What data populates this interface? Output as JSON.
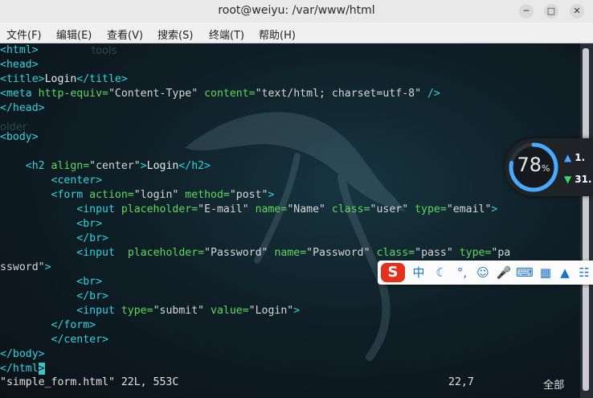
{
  "window": {
    "title": "root@weiyu: /var/www/html"
  },
  "menu": [
    "文件(F)",
    "编辑(E)",
    "查看(V)",
    "搜索(S)",
    "终端(T)",
    "帮助(H)"
  ],
  "desktop_ghost": {
    "tools": "tools",
    "folder": "older"
  },
  "editor": {
    "lines": [
      [
        [
          "tag",
          "<html>"
        ]
      ],
      [
        [
          "tag",
          "<head>"
        ]
      ],
      [
        [
          "tag",
          "<title>"
        ],
        [
          "txt",
          "Login"
        ],
        [
          "tag",
          "</title>"
        ]
      ],
      [
        [
          "tag",
          "<meta "
        ],
        [
          "attr",
          "http-equiv="
        ],
        [
          "str",
          "\"Content-Type\" "
        ],
        [
          "attr",
          "content="
        ],
        [
          "str",
          "\"text/html; charset=utf-8\" "
        ],
        [
          "tag",
          "/>"
        ]
      ],
      [
        [
          "tag",
          "</head>"
        ]
      ],
      [],
      [
        [
          "tag",
          "<body>"
        ]
      ],
      [],
      [
        [
          "txt",
          "    "
        ],
        [
          "tag",
          "<h2 "
        ],
        [
          "attr",
          "align="
        ],
        [
          "str",
          "\"center\""
        ],
        [
          "tag",
          ">"
        ],
        [
          "txt",
          "Login"
        ],
        [
          "tag",
          "</h2>"
        ]
      ],
      [
        [
          "txt",
          "        "
        ],
        [
          "tag",
          "<center>"
        ]
      ],
      [
        [
          "txt",
          "        "
        ],
        [
          "tag",
          "<form "
        ],
        [
          "attr",
          "action="
        ],
        [
          "str",
          "\"login\" "
        ],
        [
          "attr",
          "method="
        ],
        [
          "str",
          "\"post\""
        ],
        [
          "tag",
          ">"
        ]
      ],
      [
        [
          "txt",
          "            "
        ],
        [
          "tag",
          "<input "
        ],
        [
          "attr",
          "placeholder="
        ],
        [
          "str",
          "\"E-mail\" "
        ],
        [
          "attr",
          "name="
        ],
        [
          "str",
          "\"Name\" "
        ],
        [
          "attr",
          "class="
        ],
        [
          "str",
          "\"user\" "
        ],
        [
          "attr",
          "type="
        ],
        [
          "str",
          "\"email\""
        ],
        [
          "tag",
          ">"
        ]
      ],
      [
        [
          "txt",
          "            "
        ],
        [
          "tag",
          "<br>"
        ]
      ],
      [
        [
          "txt",
          "            "
        ],
        [
          "tag",
          "</br>"
        ]
      ],
      [
        [
          "txt",
          "            "
        ],
        [
          "tag",
          "<input  "
        ],
        [
          "attr",
          "placeholder="
        ],
        [
          "str",
          "\"Password\" "
        ],
        [
          "attr",
          "name="
        ],
        [
          "str",
          "\"Password\" "
        ],
        [
          "attr",
          "class="
        ],
        [
          "str",
          "\"pass\" "
        ],
        [
          "attr",
          "type="
        ],
        [
          "str",
          "\"pa"
        ]
      ],
      [
        [
          "str",
          "ssword\""
        ],
        [
          "tag",
          ">"
        ]
      ],
      [
        [
          "txt",
          "            "
        ],
        [
          "tag",
          "<br>"
        ]
      ],
      [
        [
          "txt",
          "            "
        ],
        [
          "tag",
          "</br>"
        ]
      ],
      [
        [
          "txt",
          "            "
        ],
        [
          "tag",
          "<input "
        ],
        [
          "attr",
          "type="
        ],
        [
          "str",
          "\"submit\" "
        ],
        [
          "attr",
          "value="
        ],
        [
          "str",
          "\"Login\""
        ],
        [
          "tag",
          ">"
        ]
      ],
      [
        [
          "txt",
          "        "
        ],
        [
          "tag",
          "</form>"
        ]
      ],
      [
        [
          "txt",
          "        "
        ],
        [
          "tag",
          "</center>"
        ]
      ],
      [
        [
          "tag",
          "</body>"
        ]
      ],
      [
        [
          "tag",
          "</html"
        ],
        [
          "cursor",
          ">"
        ]
      ]
    ],
    "status": {
      "file": "\"simple_form.html\" 22L, 553C",
      "position": "22,7",
      "scroll": "全部"
    }
  },
  "net_widget": {
    "percent": "78",
    "percent_sign": "%",
    "upload": "1.",
    "download": "31.",
    "level": 0.78
  },
  "ime": {
    "lang_label": "中",
    "punct_label": "°,"
  },
  "colors": {
    "tag": "#32d2e0",
    "attr": "#5fd75f",
    "string": "#d6d6d6",
    "gauge": "#4aa8ff"
  }
}
